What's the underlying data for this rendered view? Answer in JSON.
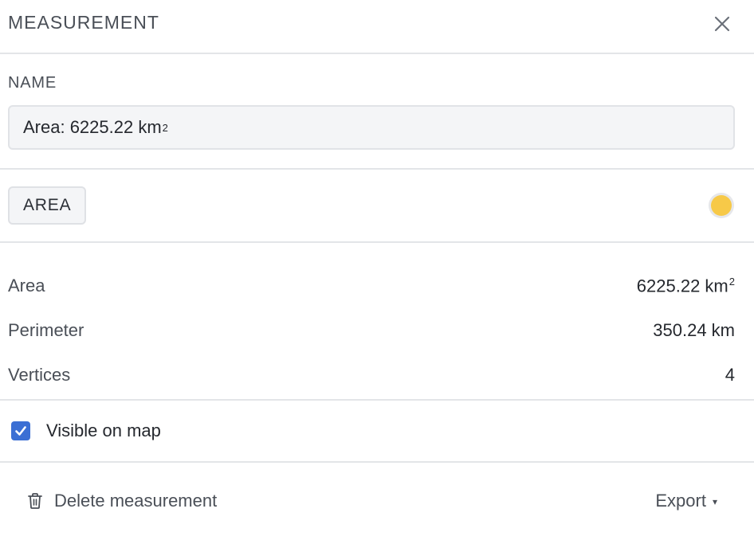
{
  "header": {
    "title": "MEASUREMENT",
    "close_icon": "close-icon"
  },
  "name_field": {
    "label": "NAME",
    "value_text": "Area: 6225.22 km",
    "value_superscript": "2"
  },
  "type": {
    "label": "AREA",
    "color": "#f7c948"
  },
  "stats": [
    {
      "label": "Area",
      "value": "6225.22 km",
      "superscript": "2"
    },
    {
      "label": "Perimeter",
      "value": "350.24 km",
      "superscript": ""
    },
    {
      "label": "Vertices",
      "value": "4",
      "superscript": ""
    }
  ],
  "visibility": {
    "label": "Visible on map",
    "checked": true
  },
  "footer": {
    "delete_label": "Delete measurement",
    "delete_icon": "trash-icon",
    "export_label": "Export",
    "export_caret": "▾"
  },
  "colors": {
    "accent": "#3b6fd4",
    "swatch": "#f7c948"
  }
}
